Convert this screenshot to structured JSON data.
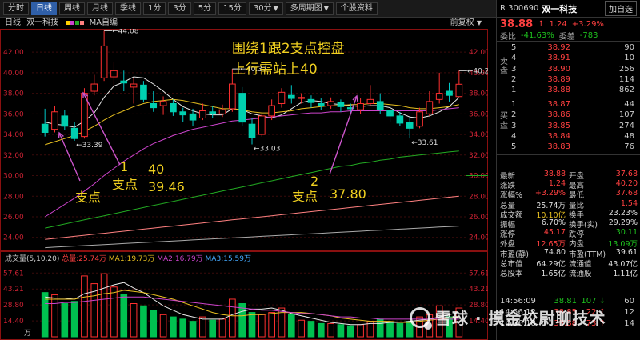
{
  "toolbar": {
    "tabs": [
      "分时",
      "日线",
      "周线",
      "月线",
      "季线",
      "1分",
      "3分",
      "5分",
      "15分",
      "30分",
      "多周期图",
      "个股资料"
    ],
    "active_index": 1
  },
  "title_bar": {
    "period": "日线",
    "stock_name": "双一科技",
    "ma_label": "MA自编",
    "adjust": "前复权",
    "ma_dots": [
      "#ffd000",
      "#cc44cc",
      "#22aa22",
      "#ff8080"
    ]
  },
  "price_labels": {
    "high_44": "44.08",
    "high_40": "40.37",
    "last_high": "40.2",
    "low_1": "33.39",
    "low_2": "33.03",
    "low_3": "33.61"
  },
  "annotations": {
    "main_line1": "围绕1跟2支点控盘",
    "main_line2": "上行需站上40",
    "zhidian1": "支点",
    "zhidian2": "支点",
    "zhidian3": "支点",
    "num1": "1",
    "num2": "2",
    "val_40": "40",
    "val_3946": "39.46",
    "val_3780": "37.80"
  },
  "volume_bar": {
    "label": "成交量(5,10,20)",
    "total": "总量:25.74万",
    "ma1": "MA1:19.73万",
    "ma2": "MA2:16.79万",
    "ma3": "MA3:15.59万",
    "unit": "万"
  },
  "right_panel": {
    "code": "R 300690",
    "name": "双一科技",
    "add_button": "加自选",
    "price": "38.88",
    "arrow": "↑",
    "change": "1.24",
    "change_pct": "+3.29%",
    "weibi_label": "委比",
    "weibi_pct": "-41.63%",
    "weibi_diff": "-783",
    "sell_label": "卖盘",
    "buy_label": "买盘",
    "sell": [
      {
        "lv": "5",
        "price": "38.92",
        "vol": "90"
      },
      {
        "lv": "4",
        "price": "38.91",
        "vol": "10"
      },
      {
        "lv": "3",
        "price": "38.90",
        "vol": "256"
      },
      {
        "lv": "2",
        "price": "38.89",
        "vol": "114"
      },
      {
        "lv": "1",
        "price": "38.88",
        "vol": "862"
      }
    ],
    "buy": [
      {
        "lv": "1",
        "price": "38.87",
        "vol": "44"
      },
      {
        "lv": "2",
        "price": "38.86",
        "vol": "107"
      },
      {
        "lv": "3",
        "price": "38.85",
        "vol": "274"
      },
      {
        "lv": "4",
        "price": "38.84",
        "vol": "48"
      },
      {
        "lv": "5",
        "price": "38.83",
        "vol": "76"
      }
    ],
    "stats": [
      {
        "k": "最新",
        "v": "38.88",
        "vc": "red",
        "k2": "开盘",
        "v2": "37.68",
        "v2c": "red"
      },
      {
        "k": "涨跌",
        "v": "1.24",
        "vc": "red",
        "k2": "最高",
        "v2": "40.20",
        "v2c": "red"
      },
      {
        "k": "涨幅%",
        "v": "+3.29%",
        "vc": "red",
        "k2": "最低",
        "v2": "37.68",
        "v2c": "red"
      },
      {
        "k": "总量",
        "v": "25.74万",
        "vc": "white",
        "k2": "量比",
        "v2": "1.54",
        "v2c": "red"
      },
      {
        "k": "成交额",
        "v": "10.10亿",
        "vc": "yellow",
        "k2": "换手",
        "v2": "23.23%",
        "v2c": "white"
      },
      {
        "k": "振幅",
        "v": "6.70%",
        "vc": "white",
        "k2": "换手(实)",
        "v2": "29.29%",
        "v2c": "white"
      },
      {
        "k": "涨停",
        "v": "45.17",
        "vc": "red",
        "k2": "跌停",
        "v2": "30.11",
        "v2c": "green"
      },
      {
        "k": "外盘",
        "v": "12.65万",
        "vc": "red",
        "k2": "内盘",
        "v2": "13.09万",
        "v2c": "green"
      },
      {
        "k": "市盈(静)",
        "v": "74.80",
        "vc": "white",
        "k2": "市盈(TTM)",
        "v2": "39.61",
        "v2c": "white"
      },
      {
        "k": "总市值",
        "v": "64.29亿",
        "vc": "white",
        "k2": "流通值",
        "v2": "43.07亿",
        "v2c": "white"
      },
      {
        "k": "总股本",
        "v": "1.65亿",
        "vc": "white",
        "k2": "流通股",
        "v2": "1.11亿",
        "v2c": "white"
      }
    ],
    "ticks": [
      {
        "t": "14:56:09",
        "p": "38.81",
        "pc": "green",
        "q": "107",
        "dir": "↓",
        "n": "60"
      },
      {
        "t": "14:56:12",
        "p": "38.85",
        "pc": "red",
        "q": "22",
        "dir": "↑",
        "n": "12"
      },
      {
        "t": "14:56:18",
        "p": "38.88",
        "pc": "red",
        "q": "73",
        "dir": "↑",
        "n": "14"
      }
    ]
  },
  "chart_data": {
    "type": "candlestick",
    "price_axis": {
      "min": 23.2,
      "max": 43.8,
      "ticks": [
        24.0,
        26.0,
        28.0,
        30.0,
        32.0,
        34.0,
        36.0,
        38.0,
        40.0,
        42.0
      ]
    },
    "volume_axis": {
      "ticks": [
        14.4,
        28.8,
        43.21,
        57.61
      ]
    },
    "candles": [
      {
        "o": 35.0,
        "c": 34.2,
        "h": 36.5,
        "l": 33.8,
        "v": 40
      },
      {
        "o": 34.5,
        "c": 36.2,
        "h": 36.8,
        "l": 34.2,
        "v": 38
      },
      {
        "o": 35.8,
        "c": 34.8,
        "h": 36.4,
        "l": 34.4,
        "v": 30
      },
      {
        "o": 34.6,
        "c": 33.6,
        "h": 35.2,
        "l": 33.39,
        "v": 32
      },
      {
        "o": 33.8,
        "c": 38.0,
        "h": 38.5,
        "l": 33.6,
        "v": 55
      },
      {
        "o": 38.2,
        "c": 38.9,
        "h": 39.8,
        "l": 37.8,
        "v": 48
      },
      {
        "o": 39.5,
        "c": 42.6,
        "h": 44.08,
        "l": 39.2,
        "v": 57
      },
      {
        "o": 39.6,
        "c": 40.2,
        "h": 41.0,
        "l": 38.6,
        "v": 45
      },
      {
        "o": 39.2,
        "c": 39.0,
        "h": 40.2,
        "l": 38.2,
        "v": 38
      },
      {
        "o": 38.6,
        "c": 38.9,
        "h": 39.5,
        "l": 37.0,
        "v": 30
      },
      {
        "o": 38.8,
        "c": 37.4,
        "h": 39.2,
        "l": 37.1,
        "v": 28
      },
      {
        "o": 37.0,
        "c": 36.6,
        "h": 38.2,
        "l": 36.2,
        "v": 24
      },
      {
        "o": 36.8,
        "c": 37.2,
        "h": 37.7,
        "l": 35.9,
        "v": 20
      },
      {
        "o": 37.0,
        "c": 36.2,
        "h": 37.4,
        "l": 35.8,
        "v": 18
      },
      {
        "o": 36.2,
        "c": 35.9,
        "h": 36.6,
        "l": 35.2,
        "v": 16
      },
      {
        "o": 36.0,
        "c": 35.4,
        "h": 36.5,
        "l": 34.8,
        "v": 14
      },
      {
        "o": 35.6,
        "c": 36.3,
        "h": 37.0,
        "l": 35.4,
        "v": 18
      },
      {
        "o": 36.2,
        "c": 36.0,
        "h": 36.8,
        "l": 35.6,
        "v": 15
      },
      {
        "o": 36.0,
        "c": 36.4,
        "h": 36.9,
        "l": 35.7,
        "v": 16
      },
      {
        "o": 36.5,
        "c": 38.9,
        "h": 40.37,
        "l": 36.2,
        "v": 34
      },
      {
        "o": 38.0,
        "c": 35.2,
        "h": 38.6,
        "l": 34.8,
        "v": 30
      },
      {
        "o": 35.0,
        "c": 33.7,
        "h": 35.6,
        "l": 33.03,
        "v": 22
      },
      {
        "o": 34.0,
        "c": 35.8,
        "h": 36.0,
        "l": 33.8,
        "v": 20
      },
      {
        "o": 35.8,
        "c": 36.8,
        "h": 37.4,
        "l": 35.4,
        "v": 22
      },
      {
        "o": 37.0,
        "c": 38.1,
        "h": 38.5,
        "l": 36.6,
        "v": 26
      },
      {
        "o": 37.8,
        "c": 37.5,
        "h": 38.8,
        "l": 37.0,
        "v": 20
      },
      {
        "o": 37.5,
        "c": 37.6,
        "h": 38.0,
        "l": 37.0,
        "v": 15
      },
      {
        "o": 37.4,
        "c": 37.1,
        "h": 37.8,
        "l": 36.6,
        "v": 14
      },
      {
        "o": 37.0,
        "c": 36.8,
        "h": 37.5,
        "l": 36.4,
        "v": 12
      },
      {
        "o": 36.8,
        "c": 37.2,
        "h": 37.6,
        "l": 36.5,
        "v": 12
      },
      {
        "o": 37.1,
        "c": 36.7,
        "h": 37.4,
        "l": 36.2,
        "v": 11
      },
      {
        "o": 36.6,
        "c": 36.5,
        "h": 37.0,
        "l": 36.1,
        "v": 10
      },
      {
        "o": 36.4,
        "c": 37.0,
        "h": 37.5,
        "l": 36.0,
        "v": 11
      },
      {
        "o": 37.0,
        "c": 37.4,
        "h": 38.8,
        "l": 36.8,
        "v": 14
      },
      {
        "o": 37.2,
        "c": 36.4,
        "h": 38.0,
        "l": 36.0,
        "v": 16
      },
      {
        "o": 36.3,
        "c": 35.8,
        "h": 36.8,
        "l": 35.2,
        "v": 13
      },
      {
        "o": 35.8,
        "c": 35.1,
        "h": 36.2,
        "l": 34.8,
        "v": 12
      },
      {
        "o": 35.2,
        "c": 34.6,
        "h": 35.6,
        "l": 33.61,
        "v": 14
      },
      {
        "o": 34.8,
        "c": 36.2,
        "h": 36.6,
        "l": 34.6,
        "v": 18
      },
      {
        "o": 36.0,
        "c": 37.2,
        "h": 38.2,
        "l": 35.8,
        "v": 20
      },
      {
        "o": 37.4,
        "c": 38.0,
        "h": 40.0,
        "l": 37.0,
        "v": 28
      },
      {
        "o": 38.2,
        "c": 37.8,
        "h": 39.0,
        "l": 37.2,
        "v": 18
      },
      {
        "o": 37.68,
        "c": 38.88,
        "h": 40.2,
        "l": 37.68,
        "v": 26
      }
    ],
    "ma_lines": [
      {
        "color": "#e8e8e8",
        "values": [
          35.2,
          35.0,
          34.9,
          34.7,
          35.3,
          36.1,
          37.6,
          38.7,
          39.1,
          39.6,
          39.5,
          38.9,
          38.2,
          37.4,
          36.7,
          36.3,
          36.0,
          35.9,
          35.9,
          36.5,
          36.4,
          36.0,
          35.8,
          35.6,
          35.9,
          36.5,
          37.1,
          37.3,
          37.2,
          37.0,
          36.9,
          36.8,
          36.7,
          36.8,
          36.8,
          36.6,
          36.1,
          35.7,
          35.6,
          35.8,
          36.2,
          36.7,
          37.6
        ]
      },
      {
        "color": "#e8c020",
        "values": [
          33.0,
          33.3,
          33.6,
          33.9,
          34.3,
          34.8,
          35.4,
          35.9,
          36.3,
          36.7,
          37.0,
          37.2,
          37.3,
          37.4,
          37.3,
          37.1,
          36.9,
          36.7,
          36.5,
          36.5,
          36.4,
          36.2,
          36.1,
          36.1,
          36.2,
          36.3,
          36.5,
          36.6,
          36.7,
          36.8,
          36.8,
          36.9,
          36.9,
          37.0,
          37.0,
          36.9,
          36.8,
          36.6,
          36.5,
          36.5,
          36.6,
          36.7,
          36.9
        ]
      },
      {
        "color": "#cc44cc",
        "values": [
          26.0,
          26.6,
          27.2,
          27.8,
          28.5,
          29.2,
          30.0,
          30.7,
          31.4,
          32.0,
          32.6,
          33.1,
          33.5,
          33.9,
          34.2,
          34.5,
          34.7,
          34.9,
          35.1,
          35.3,
          35.4,
          35.5,
          35.6,
          35.7,
          35.8,
          35.9,
          36.0,
          36.1,
          36.1,
          36.2,
          36.2,
          36.3,
          36.3,
          36.3,
          36.3,
          36.3,
          36.3,
          36.3,
          36.3,
          36.3,
          36.4,
          36.5,
          36.6
        ]
      },
      {
        "color": "#22aa22",
        "values": [
          24.9,
          25.1,
          25.3,
          25.5,
          25.7,
          25.9,
          26.1,
          26.3,
          26.5,
          26.7,
          26.9,
          27.1,
          27.3,
          27.5,
          27.7,
          27.9,
          28.1,
          28.3,
          28.5,
          28.7,
          28.9,
          29.1,
          29.3,
          29.5,
          29.7,
          29.9,
          30.1,
          30.3,
          30.5,
          30.7,
          30.9,
          31.0,
          31.2,
          31.3,
          31.5,
          31.6,
          31.8,
          31.9,
          32.0,
          32.1,
          32.2,
          32.3,
          32.4
        ]
      },
      {
        "color": "#ff8080",
        "values": [
          23.8,
          23.9,
          24.0,
          24.1,
          24.2,
          24.3,
          24.4,
          24.5,
          24.6,
          24.7,
          24.8,
          24.9,
          25.0,
          25.1,
          25.2,
          25.3,
          25.4,
          25.5,
          25.6,
          25.7,
          25.8,
          25.9,
          26.0,
          26.1,
          26.2,
          26.3,
          26.4,
          26.5,
          26.6,
          26.7,
          26.8,
          26.9,
          27.0,
          27.1,
          27.2,
          27.3,
          27.4,
          27.5,
          27.6,
          27.7,
          27.8,
          27.9,
          28.0
        ]
      },
      {
        "color": "#aaaaaa",
        "values": [
          23.0,
          23.05,
          23.1,
          23.15,
          23.2,
          23.25,
          23.3,
          23.35,
          23.4,
          23.45,
          23.5,
          23.55,
          23.6,
          23.65,
          23.7,
          23.75,
          23.8,
          23.85,
          23.9,
          23.95,
          24.0,
          24.05,
          24.1,
          24.15,
          24.2,
          24.25,
          24.3,
          24.35,
          24.4,
          24.45,
          24.5,
          24.55,
          24.6,
          24.65,
          24.7,
          24.75,
          24.8,
          24.85,
          24.9,
          24.95,
          25.0,
          25.05,
          25.1
        ]
      }
    ],
    "volume_ma_lines": [
      {
        "color": "#e8e8e8",
        "values": [
          36,
          35,
          35,
          34,
          39,
          41,
          44,
          47,
          49,
          44,
          40,
          34,
          28,
          24,
          20,
          18,
          16,
          16,
          16,
          20,
          23,
          25,
          25,
          26,
          24,
          21,
          19,
          17,
          15,
          13,
          12,
          11,
          11,
          12,
          12,
          13,
          13,
          14,
          15,
          16,
          18,
          20,
          22
        ]
      },
      {
        "color": "#e8c020",
        "values": [
          34,
          34,
          34,
          34,
          36,
          37,
          39,
          40,
          42,
          41,
          40,
          38,
          36,
          34,
          31,
          28,
          25,
          22,
          20,
          19,
          19,
          20,
          20,
          21,
          22,
          22,
          22,
          21,
          20,
          19,
          17,
          16,
          15,
          14,
          14,
          14,
          13,
          13,
          14,
          15,
          16,
          17,
          18
        ]
      },
      {
        "color": "#cc44cc",
        "values": [
          30,
          30,
          31,
          31,
          32,
          33,
          34,
          35,
          36,
          36,
          36,
          35,
          34,
          33,
          32,
          31,
          30,
          29,
          28,
          27,
          26,
          25,
          24,
          24,
          23,
          22,
          21,
          21,
          20,
          19,
          18,
          18,
          17,
          17,
          16,
          16,
          16,
          16,
          16,
          16,
          16,
          16,
          16
        ]
      }
    ]
  }
}
